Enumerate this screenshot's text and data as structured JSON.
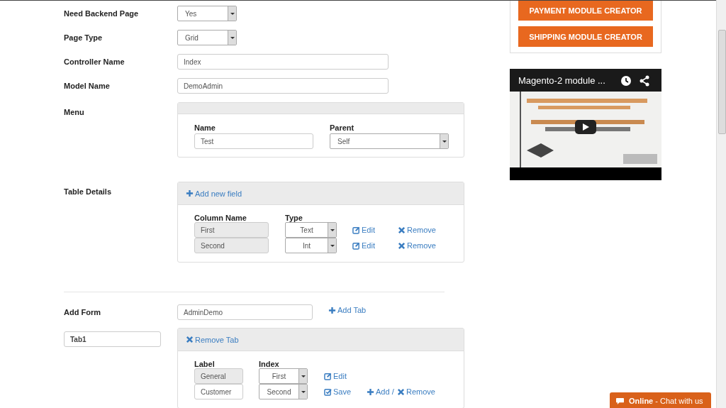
{
  "form": {
    "fields": [
      {
        "label": "Need Backend Page",
        "kind": "select",
        "value": "Yes"
      },
      {
        "label": "Page Type",
        "kind": "select",
        "value": "Grid"
      },
      {
        "label": "Controller Name",
        "kind": "text",
        "value": "Index"
      },
      {
        "label": "Model Name",
        "kind": "text",
        "value": "DemoAdmin"
      }
    ]
  },
  "menu": {
    "label": "Menu",
    "name_label": "Name",
    "name_value": "Test",
    "parent_label": "Parent",
    "parent_value": "Self"
  },
  "table_details": {
    "label": "Table Details",
    "add_link": "Add new field",
    "columns": [
      "Column Name",
      "Type"
    ],
    "rows": [
      {
        "name": "First",
        "type": "Text",
        "disabled": true,
        "actions": [
          {
            "kind": "edit",
            "text": "Edit"
          },
          {
            "kind": "remove",
            "text": "Remove"
          }
        ]
      },
      {
        "name": "Second",
        "type": "Int",
        "disabled": true,
        "actions": [
          {
            "kind": "edit",
            "text": "Edit"
          },
          {
            "kind": "remove",
            "text": "Remove"
          }
        ]
      }
    ]
  },
  "add_form": {
    "label": "Add Form",
    "value": "AdminDemo",
    "add_tab": "Add Tab",
    "tab_name": "Tab1",
    "remove_tab": "Remove Tab",
    "columns": [
      "Label",
      "Index"
    ],
    "rows": [
      {
        "label": "General",
        "index": "First",
        "disabled": true,
        "actions": [
          {
            "kind": "edit",
            "text": "Edit"
          }
        ]
      },
      {
        "label": "Customer",
        "index": "Second",
        "disabled": false,
        "actions": [
          {
            "kind": "save",
            "text": "Save"
          },
          {
            "kind": "add",
            "text": "Add /"
          },
          {
            "kind": "remove",
            "text": "Remove"
          }
        ]
      }
    ]
  },
  "sidebar": {
    "buttons": [
      "PAYMENT MODULE CREATOR",
      "SHIPPING MODULE CREATOR"
    ],
    "video": {
      "kind": "picture",
      "title": "Magento-2 module ..."
    }
  },
  "chat": {
    "status": "Online",
    "text": "- Chat with us"
  }
}
